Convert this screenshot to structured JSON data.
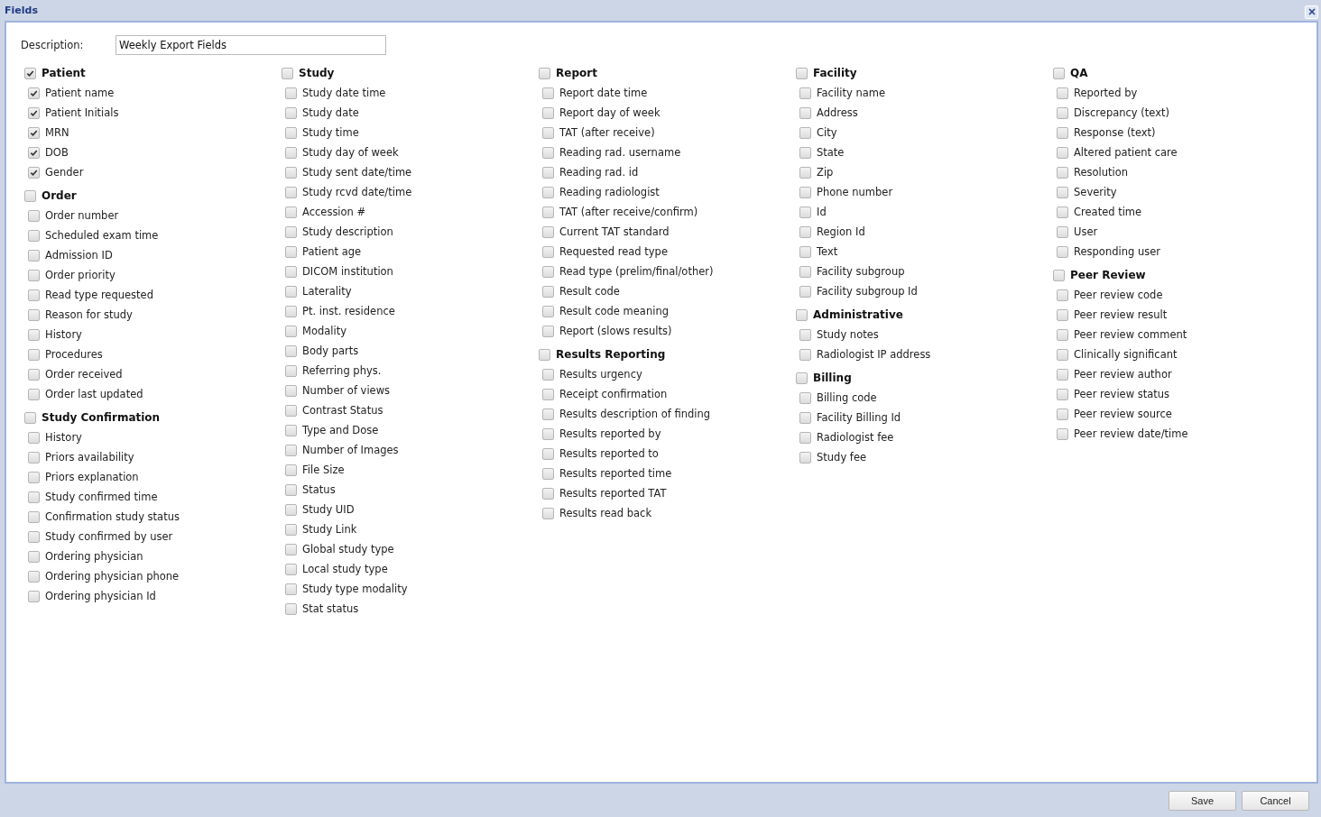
{
  "window": {
    "title": "Fields"
  },
  "description": {
    "label": "Description:",
    "value": "Weekly Export Fields"
  },
  "columns": [
    [
      {
        "label": "Patient",
        "checked": true,
        "items": [
          {
            "label": "Patient name",
            "checked": true
          },
          {
            "label": "Patient Initials",
            "checked": true
          },
          {
            "label": "MRN",
            "checked": true
          },
          {
            "label": "DOB",
            "checked": true
          },
          {
            "label": "Gender",
            "checked": true
          }
        ]
      },
      {
        "label": "Order",
        "checked": false,
        "items": [
          {
            "label": "Order number",
            "checked": false
          },
          {
            "label": "Scheduled exam time",
            "checked": false
          },
          {
            "label": "Admission ID",
            "checked": false
          },
          {
            "label": "Order priority",
            "checked": false
          },
          {
            "label": "Read type requested",
            "checked": false
          },
          {
            "label": "Reason for study",
            "checked": false
          },
          {
            "label": "History",
            "checked": false
          },
          {
            "label": "Procedures",
            "checked": false
          },
          {
            "label": "Order received",
            "checked": false
          },
          {
            "label": "Order last updated",
            "checked": false
          }
        ]
      },
      {
        "label": "Study Confirmation",
        "checked": false,
        "items": [
          {
            "label": "History",
            "checked": false
          },
          {
            "label": "Priors availability",
            "checked": false
          },
          {
            "label": "Priors explanation",
            "checked": false
          },
          {
            "label": "Study confirmed time",
            "checked": false
          },
          {
            "label": "Confirmation study status",
            "checked": false
          },
          {
            "label": "Study confirmed by user",
            "checked": false
          },
          {
            "label": "Ordering physician",
            "checked": false
          },
          {
            "label": "Ordering physician phone",
            "checked": false
          },
          {
            "label": "Ordering physician Id",
            "checked": false
          }
        ]
      }
    ],
    [
      {
        "label": "Study",
        "checked": false,
        "items": [
          {
            "label": "Study date time",
            "checked": false
          },
          {
            "label": "Study date",
            "checked": false
          },
          {
            "label": "Study time",
            "checked": false
          },
          {
            "label": "Study day of week",
            "checked": false
          },
          {
            "label": "Study sent date/time",
            "checked": false
          },
          {
            "label": "Study rcvd date/time",
            "checked": false
          },
          {
            "label": "Accession #",
            "checked": false
          },
          {
            "label": "Study description",
            "checked": false
          },
          {
            "label": "Patient age",
            "checked": false
          },
          {
            "label": "DICOM institution",
            "checked": false
          },
          {
            "label": "Laterality",
            "checked": false
          },
          {
            "label": "Pt. inst. residence",
            "checked": false
          },
          {
            "label": "Modality",
            "checked": false
          },
          {
            "label": "Body parts",
            "checked": false
          },
          {
            "label": "Referring phys.",
            "checked": false
          },
          {
            "label": "Number of views",
            "checked": false
          },
          {
            "label": "Contrast Status",
            "checked": false
          },
          {
            "label": "Type and Dose",
            "checked": false
          },
          {
            "label": "Number of Images",
            "checked": false
          },
          {
            "label": "File Size",
            "checked": false
          },
          {
            "label": "Status",
            "checked": false
          },
          {
            "label": "Study UID",
            "checked": false
          },
          {
            "label": "Study Link",
            "checked": false
          },
          {
            "label": "Global study type",
            "checked": false
          },
          {
            "label": "Local study type",
            "checked": false
          },
          {
            "label": "Study type modality",
            "checked": false
          },
          {
            "label": "Stat status",
            "checked": false
          }
        ]
      }
    ],
    [
      {
        "label": "Report",
        "checked": false,
        "items": [
          {
            "label": "Report date time",
            "checked": false
          },
          {
            "label": "Report day of week",
            "checked": false
          },
          {
            "label": "TAT (after receive)",
            "checked": false
          },
          {
            "label": "Reading rad. username",
            "checked": false
          },
          {
            "label": "Reading rad. id",
            "checked": false
          },
          {
            "label": "Reading radiologist",
            "checked": false
          },
          {
            "label": "TAT (after receive/confirm)",
            "checked": false
          },
          {
            "label": "Current TAT standard",
            "checked": false
          },
          {
            "label": "Requested read type",
            "checked": false
          },
          {
            "label": "Read type (prelim/final/other)",
            "checked": false
          },
          {
            "label": "Result code",
            "checked": false
          },
          {
            "label": "Result code meaning",
            "checked": false
          },
          {
            "label": "Report (slows results)",
            "checked": false
          }
        ]
      },
      {
        "label": "Results Reporting",
        "checked": false,
        "items": [
          {
            "label": "Results urgency",
            "checked": false
          },
          {
            "label": "Receipt confirmation",
            "checked": false
          },
          {
            "label": "Results description of finding",
            "checked": false
          },
          {
            "label": "Results reported by",
            "checked": false
          },
          {
            "label": "Results reported to",
            "checked": false
          },
          {
            "label": "Results reported time",
            "checked": false
          },
          {
            "label": "Results reported TAT",
            "checked": false
          },
          {
            "label": "Results read back",
            "checked": false
          }
        ]
      }
    ],
    [
      {
        "label": "Facility",
        "checked": false,
        "items": [
          {
            "label": "Facility name",
            "checked": false
          },
          {
            "label": "Address",
            "checked": false
          },
          {
            "label": "City",
            "checked": false
          },
          {
            "label": "State",
            "checked": false
          },
          {
            "label": "Zip",
            "checked": false
          },
          {
            "label": "Phone number",
            "checked": false
          },
          {
            "label": "Id",
            "checked": false
          },
          {
            "label": "Region Id",
            "checked": false
          },
          {
            "label": "Text",
            "checked": false
          },
          {
            "label": "Facility subgroup",
            "checked": false
          },
          {
            "label": "Facility subgroup Id",
            "checked": false
          }
        ]
      },
      {
        "label": "Administrative",
        "checked": false,
        "items": [
          {
            "label": "Study notes",
            "checked": false
          },
          {
            "label": "Radiologist IP address",
            "checked": false
          }
        ]
      },
      {
        "label": "Billing",
        "checked": false,
        "items": [
          {
            "label": "Billing code",
            "checked": false
          },
          {
            "label": "Facility Billing Id",
            "checked": false
          },
          {
            "label": "Radiologist fee",
            "checked": false
          },
          {
            "label": "Study fee",
            "checked": false
          }
        ]
      }
    ],
    [
      {
        "label": "QA",
        "checked": false,
        "items": [
          {
            "label": "Reported by",
            "checked": false
          },
          {
            "label": "Discrepancy (text)",
            "checked": false
          },
          {
            "label": "Response (text)",
            "checked": false
          },
          {
            "label": "Altered patient care",
            "checked": false
          },
          {
            "label": "Resolution",
            "checked": false
          },
          {
            "label": "Severity",
            "checked": false
          },
          {
            "label": "Created time",
            "checked": false
          },
          {
            "label": "User",
            "checked": false
          },
          {
            "label": "Responding user",
            "checked": false
          }
        ]
      },
      {
        "label": "Peer Review",
        "checked": false,
        "items": [
          {
            "label": "Peer review code",
            "checked": false
          },
          {
            "label": "Peer review result",
            "checked": false
          },
          {
            "label": "Peer review comment",
            "checked": false
          },
          {
            "label": "Clinically significant",
            "checked": false
          },
          {
            "label": "Peer review author",
            "checked": false
          },
          {
            "label": "Peer review status",
            "checked": false
          },
          {
            "label": "Peer review source",
            "checked": false
          },
          {
            "label": "Peer review date/time",
            "checked": false
          }
        ]
      }
    ]
  ],
  "buttons": [
    "Save",
    "Cancel"
  ]
}
